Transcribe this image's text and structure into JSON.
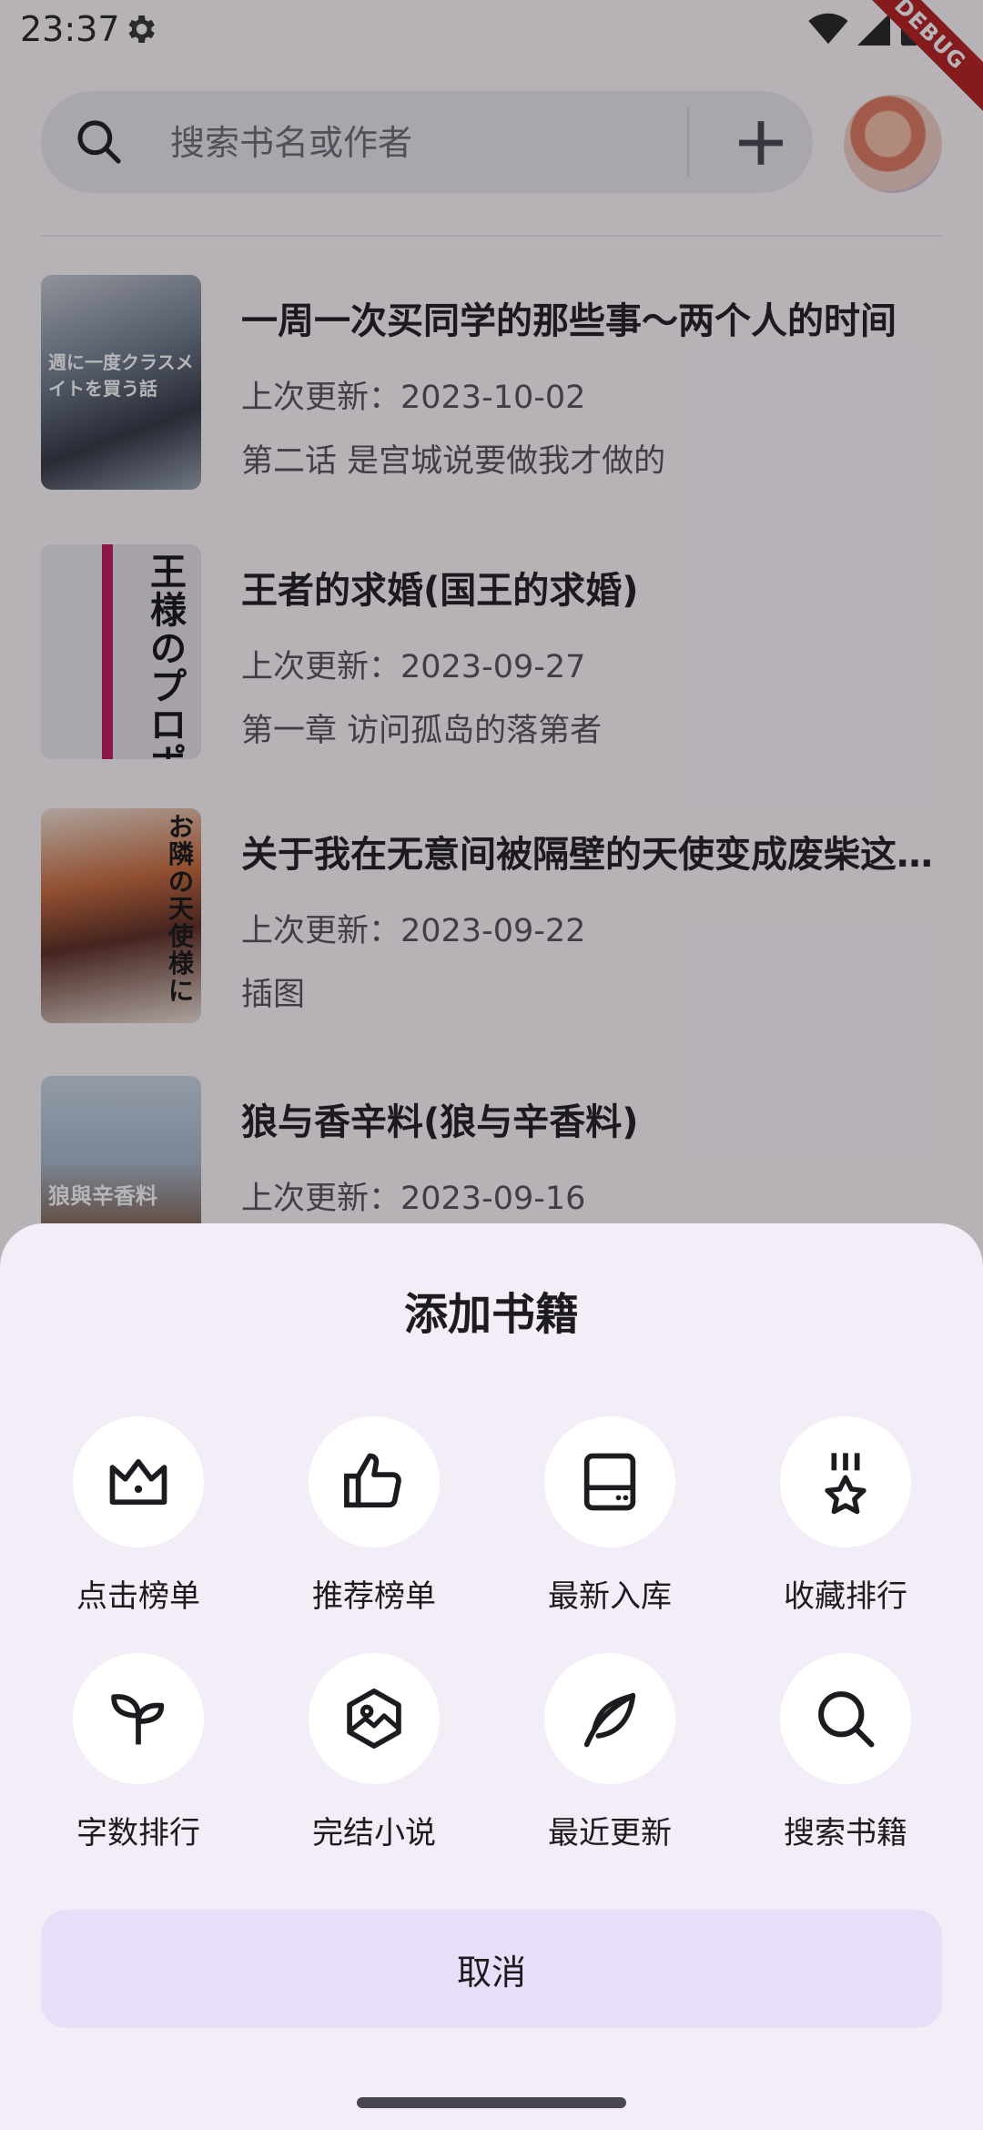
{
  "status_bar": {
    "time": "23:37",
    "debug_label": "DEBUG"
  },
  "search": {
    "placeholder": "搜索书名或作者"
  },
  "books": [
    {
      "title": "一周一次买同学的那些事～两个人的时间",
      "updated": "上次更新：2023-10-02",
      "chapter": "第二话 是宫城说要做我才做的",
      "cover_text": "週に一度クラスメイトを買う話"
    },
    {
      "title": "王者的求婚(国王的求婚)",
      "updated": "上次更新：2023-09-27",
      "chapter": "第一章 访问孤岛的落第者",
      "cover_text": "王様のプロポーズ"
    },
    {
      "title": "关于我在无意间被隔壁的天使变成废柴这件事",
      "updated": "上次更新：2023-09-22",
      "chapter": "插图",
      "cover_text": "お隣の天使様に"
    },
    {
      "title": "狼与香辛料(狼与辛香料)",
      "updated": "上次更新：2023-09-16",
      "chapter": "",
      "cover_text": "狼與辛香料"
    }
  ],
  "sheet": {
    "title": "添加书籍",
    "actions": [
      {
        "label": "点击榜单",
        "icon": "crown-icon"
      },
      {
        "label": "推荐榜单",
        "icon": "thumb-up-icon"
      },
      {
        "label": "最新入库",
        "icon": "storage-drive-icon"
      },
      {
        "label": "收藏排行",
        "icon": "star-medal-icon"
      },
      {
        "label": "字数排行",
        "icon": "sprout-icon"
      },
      {
        "label": "完结小说",
        "icon": "hexagon-image-icon"
      },
      {
        "label": "最近更新",
        "icon": "feather-icon"
      },
      {
        "label": "搜索书籍",
        "icon": "search-icon"
      }
    ],
    "cancel_label": "取消"
  },
  "colors": {
    "sheet_bg": "#f3edf7",
    "cancel_bg": "#e8def8",
    "scrim": "rgba(28,24,32,0.32)"
  }
}
